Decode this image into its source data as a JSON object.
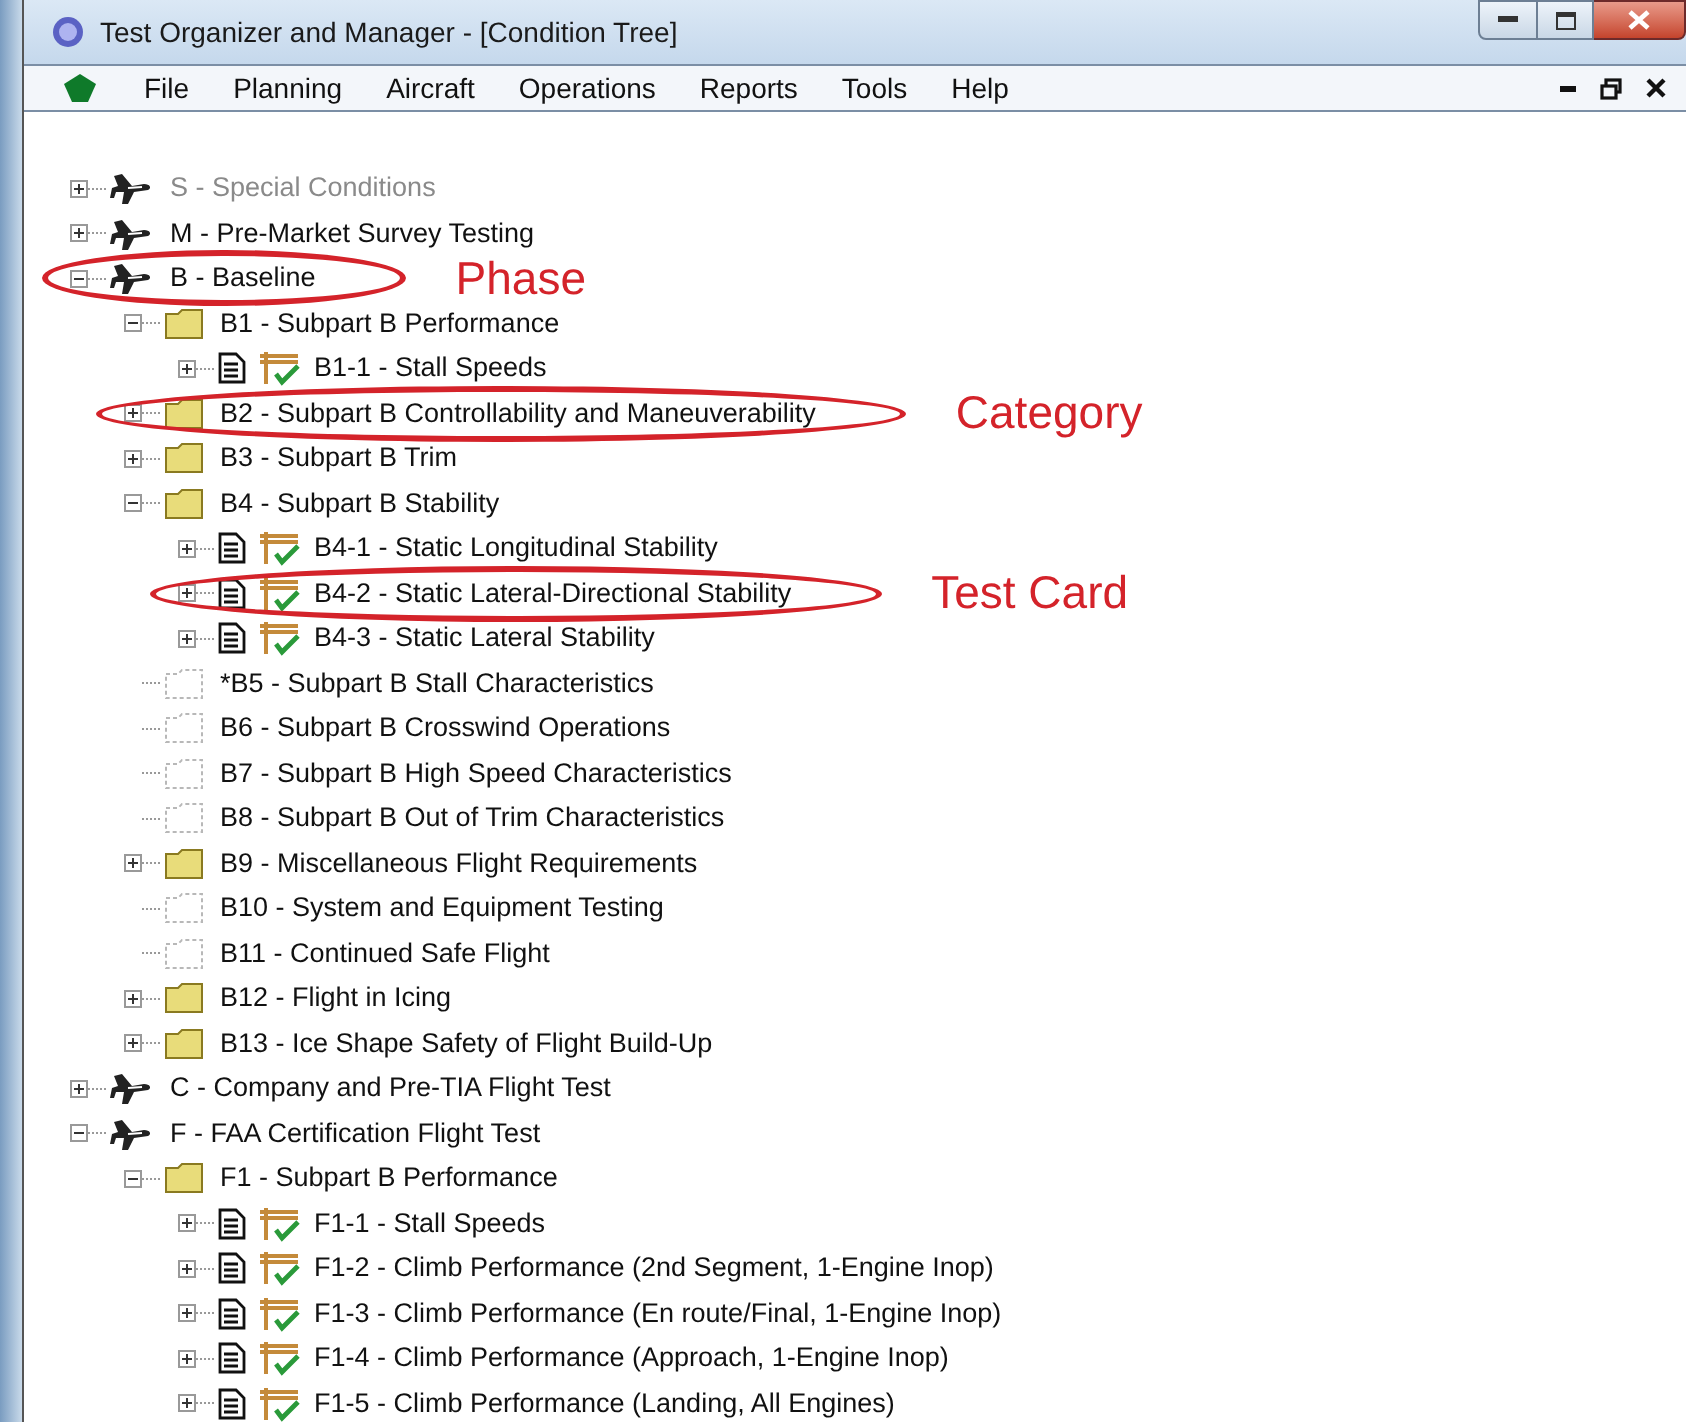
{
  "window": {
    "title": "Test Organizer and Manager - [Condition Tree]"
  },
  "menu": [
    "File",
    "Planning",
    "Aircraft",
    "Operations",
    "Reports",
    "Tools",
    "Help"
  ],
  "tree": [
    {
      "kind": "phase",
      "label": "S - Special Conditions",
      "disabled": true,
      "expanded": false
    },
    {
      "kind": "phase",
      "label": "M - Pre-Market Survey Testing",
      "disabled": false,
      "expanded": false
    },
    {
      "kind": "phase",
      "label": "B - Baseline",
      "disabled": false,
      "expanded": true,
      "callout": "Phase",
      "children": [
        {
          "kind": "category",
          "label": "B1 - Subpart B Performance",
          "expanded": true,
          "children": [
            {
              "kind": "card",
              "label": "B1-1 - Stall Speeds",
              "expanded": false
            }
          ]
        },
        {
          "kind": "category",
          "label": "B2 - Subpart B Controllability and Maneuverability",
          "expanded": false,
          "callout": "Category"
        },
        {
          "kind": "category",
          "label": "B3 - Subpart B Trim",
          "expanded": false
        },
        {
          "kind": "category",
          "label": "B4 - Subpart B Stability",
          "expanded": true,
          "children": [
            {
              "kind": "card",
              "label": "B4-1 - Static Longitudinal Stability",
              "expanded": false
            },
            {
              "kind": "card",
              "label": "B4-2 - Static Lateral-Directional Stability",
              "expanded": false,
              "callout": "Test Card"
            },
            {
              "kind": "card",
              "label": "B4-3 - Static Lateral Stability",
              "expanded": false
            }
          ]
        },
        {
          "kind": "empty",
          "label": "*B5 - Subpart B Stall Characteristics"
        },
        {
          "kind": "empty",
          "label": "B6 - Subpart B Crosswind Operations"
        },
        {
          "kind": "empty",
          "label": "B7 - Subpart B High Speed Characteristics"
        },
        {
          "kind": "empty",
          "label": "B8 - Subpart B Out of Trim Characteristics"
        },
        {
          "kind": "category",
          "label": "B9 - Miscellaneous Flight Requirements",
          "expanded": false
        },
        {
          "kind": "empty",
          "label": "B10 - System and Equipment Testing"
        },
        {
          "kind": "empty",
          "label": "B11 - Continued Safe Flight"
        },
        {
          "kind": "category",
          "label": "B12 - Flight in Icing",
          "expanded": false
        },
        {
          "kind": "category",
          "label": "B13 - Ice Shape Safety of Flight Build-Up",
          "expanded": false
        }
      ]
    },
    {
      "kind": "phase",
      "label": "C - Company and Pre-TIA Flight Test",
      "disabled": false,
      "expanded": false
    },
    {
      "kind": "phase",
      "label": "F - FAA Certification Flight Test",
      "disabled": false,
      "expanded": true,
      "children": [
        {
          "kind": "category",
          "label": "F1 - Subpart B Performance",
          "expanded": true,
          "children": [
            {
              "kind": "card",
              "label": "F1-1 - Stall Speeds",
              "expanded": false
            },
            {
              "kind": "card",
              "label": "F1-2 - Climb Performance (2nd Segment, 1-Engine Inop)",
              "expanded": false
            },
            {
              "kind": "card",
              "label": "F1-3 - Climb Performance (En route/Final, 1-Engine Inop)",
              "expanded": false
            },
            {
              "kind": "card",
              "label": "F1-4 - Climb Performance (Approach, 1-Engine Inop)",
              "expanded": false
            },
            {
              "kind": "card",
              "label": "F1-5 - Climb Performance (Landing, All Engines)",
              "expanded": false
            }
          ]
        }
      ]
    }
  ]
}
